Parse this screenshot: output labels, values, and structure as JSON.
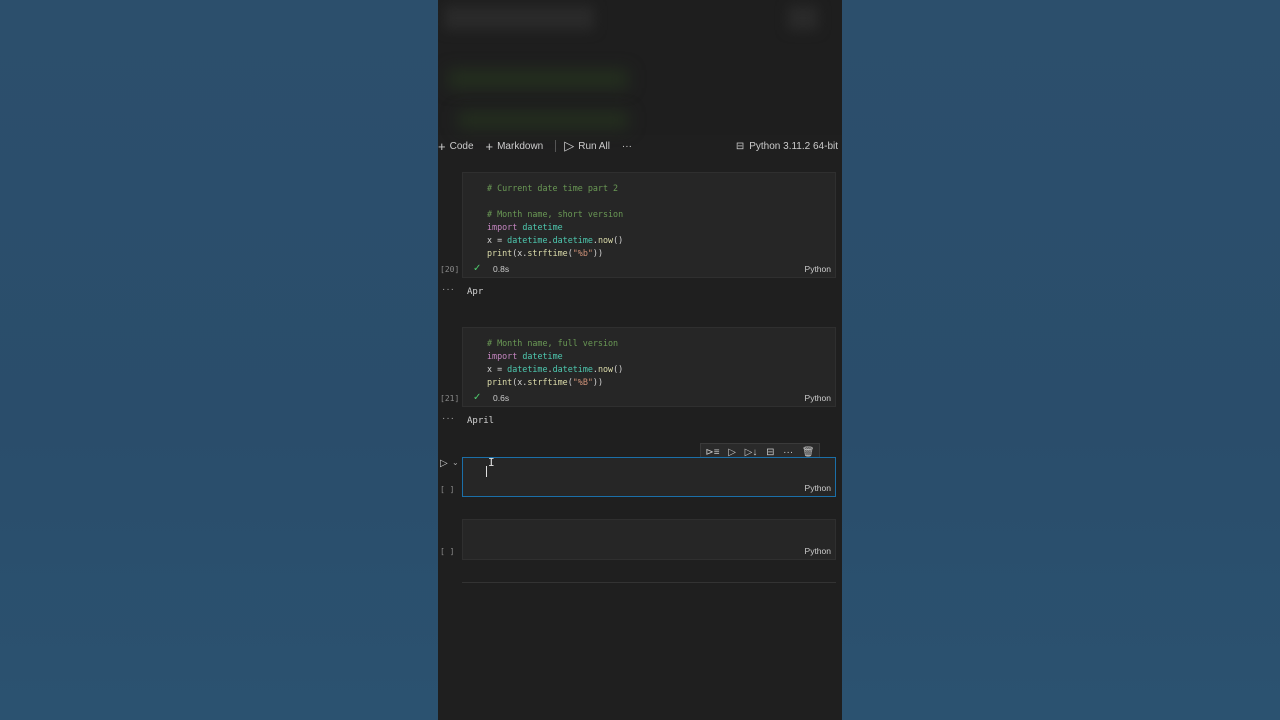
{
  "toolbar": {
    "code_label": "Code",
    "markdown_label": "Markdown",
    "run_all_label": "Run All",
    "more_label": "···",
    "kernel_label": "Python 3.11.2 64-bit"
  },
  "cells": [
    {
      "exec_count": "[20]",
      "lines": [
        "# Current date time part 2",
        "",
        "# Month name, short version",
        "import datetime",
        "x = datetime.datetime.now()",
        "print(x.strftime(\"%b\"))"
      ],
      "duration": "0.8s",
      "language": "Python",
      "output": "Apr",
      "output_dots": "···"
    },
    {
      "exec_count": "[21]",
      "lines": [
        "# Month name, full version",
        "import datetime",
        "x = datetime.datetime.now()",
        "print(x.strftime(\"%B\"))"
      ],
      "duration": "0.6s",
      "language": "Python",
      "output": "April",
      "output_dots": "···"
    },
    {
      "exec_count": "[ ]",
      "language": "Python"
    },
    {
      "exec_count": "[ ]",
      "language": "Python"
    }
  ],
  "icons": {
    "add": "plus-icon",
    "run": "play-icon",
    "kernel": "kernel-icon",
    "check": "check-icon",
    "delete": "trash-icon"
  },
  "colors": {
    "accent_border": "#1b6fa8",
    "comment": "#6a9955",
    "keyword": "#c586c0",
    "success": "#4ec96b"
  }
}
